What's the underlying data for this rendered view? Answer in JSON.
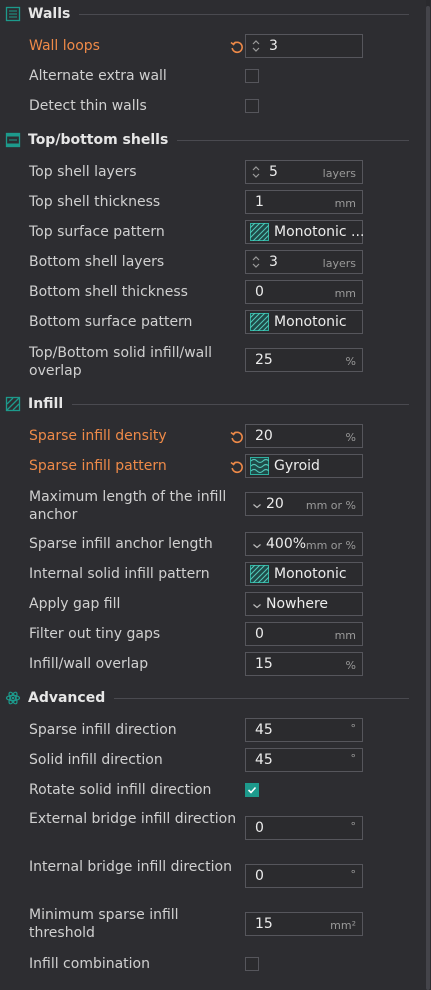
{
  "colors": {
    "background": "#2d2d31",
    "modified_label": "#ef8a48",
    "accent_teal": "#1d9a8c",
    "field_border": "#56565c"
  },
  "sections": {
    "walls": {
      "title": "Walls",
      "icon": "walls-icon"
    },
    "shells": {
      "title": "Top/bottom shells",
      "icon": "shells-icon"
    },
    "infill": {
      "title": "Infill",
      "icon": "infill-icon"
    },
    "advanced": {
      "title": "Advanced",
      "icon": "advanced-icon"
    }
  },
  "settings": {
    "wall_loops": {
      "label": "Wall loops",
      "value": "3",
      "modified": true
    },
    "alternate_extra_wall": {
      "label": "Alternate extra wall",
      "checked": false
    },
    "detect_thin_walls": {
      "label": "Detect thin walls",
      "checked": false
    },
    "top_shell_layers": {
      "label": "Top shell layers",
      "value": "5",
      "unit": "layers"
    },
    "top_shell_thickness": {
      "label": "Top shell thickness",
      "value": "1",
      "unit": "mm"
    },
    "top_surface_pattern": {
      "label": "Top surface pattern",
      "value": "Monotonic ..."
    },
    "bottom_shell_layers": {
      "label": "Bottom shell layers",
      "value": "3",
      "unit": "layers"
    },
    "bottom_shell_thickness": {
      "label": "Bottom shell thickness",
      "value": "0",
      "unit": "mm"
    },
    "bottom_surface_pattern": {
      "label": "Bottom surface pattern",
      "value": "Monotonic"
    },
    "top_bottom_overlap": {
      "label": "Top/Bottom solid infill/wall overlap",
      "value": "25",
      "unit": "%"
    },
    "sparse_infill_density": {
      "label": "Sparse infill density",
      "value": "20",
      "unit": "%",
      "modified": true
    },
    "sparse_infill_pattern": {
      "label": "Sparse infill pattern",
      "value": "Gyroid",
      "modified": true
    },
    "max_infill_anchor": {
      "label": "Maximum length of the infill anchor",
      "value": "20",
      "unit": "mm or %"
    },
    "infill_anchor_length": {
      "label": "Sparse infill anchor length",
      "value": "400%",
      "unit": "mm or %"
    },
    "internal_solid_pattern": {
      "label": "Internal solid infill pattern",
      "value": "Monotonic"
    },
    "apply_gap_fill": {
      "label": "Apply gap fill",
      "value": "Nowhere"
    },
    "filter_tiny_gaps": {
      "label": "Filter out tiny gaps",
      "value": "0",
      "unit": "mm"
    },
    "infill_wall_overlap": {
      "label": "Infill/wall overlap",
      "value": "15",
      "unit": "%"
    },
    "sparse_infill_direction": {
      "label": "Sparse infill direction",
      "value": "45",
      "unit": "°"
    },
    "solid_infill_direction": {
      "label": "Solid infill direction",
      "value": "45",
      "unit": "°"
    },
    "rotate_solid_infill": {
      "label": "Rotate solid infill direction",
      "checked": true
    },
    "external_bridge_direction": {
      "label": "External bridge infill direction",
      "value": "0",
      "unit": "°"
    },
    "internal_bridge_direction": {
      "label": "Internal bridge infill direction",
      "value": "0",
      "unit": "°"
    },
    "min_sparse_threshold": {
      "label": "Minimum sparse infill threshold",
      "value": "15",
      "unit": "mm²"
    },
    "infill_combination": {
      "label": "Infill combination",
      "checked": false
    }
  }
}
